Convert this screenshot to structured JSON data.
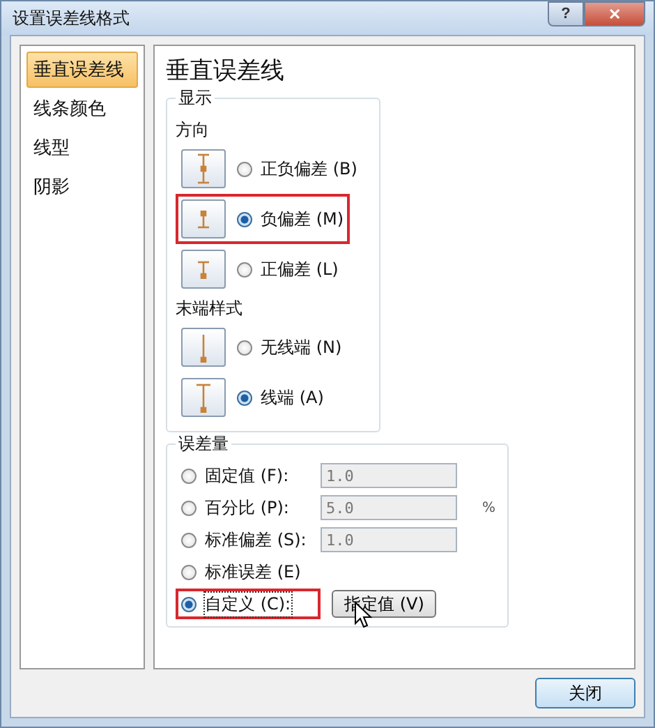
{
  "window": {
    "title": "设置误差线格式",
    "help": "?",
    "close": "✕"
  },
  "sidebar": {
    "items": [
      {
        "label": "垂直误差线",
        "selected": true
      },
      {
        "label": "线条颜色",
        "selected": false
      },
      {
        "label": "线型",
        "selected": false
      },
      {
        "label": "阴影",
        "selected": false
      }
    ]
  },
  "heading": "垂直误差线",
  "display": {
    "title": "显示",
    "direction": {
      "title": "方向",
      "options": [
        {
          "label": "正负偏差 (B)",
          "kind": "both",
          "selected": false,
          "highlighted": false
        },
        {
          "label": "负偏差 (M)",
          "kind": "minus",
          "selected": true,
          "highlighted": true
        },
        {
          "label": "正偏差 (L)",
          "kind": "plus",
          "selected": false,
          "highlighted": false
        }
      ]
    },
    "end_style": {
      "title": "末端样式",
      "options": [
        {
          "label": "无线端 (N)",
          "kind": "nocap",
          "selected": false,
          "highlighted": false
        },
        {
          "label": "线端 (A)",
          "kind": "cap",
          "selected": true,
          "highlighted": false
        }
      ]
    }
  },
  "amount": {
    "title": "误差量",
    "options": [
      {
        "label": "固定值 (F):",
        "kind": "field",
        "value": "1.0",
        "selected": false,
        "highlighted": false
      },
      {
        "label": "百分比 (P):",
        "kind": "field",
        "value": "5.0",
        "unit": "%",
        "selected": false,
        "highlighted": false
      },
      {
        "label": "标准偏差 (S):",
        "kind": "field",
        "value": "1.0",
        "selected": false,
        "highlighted": false
      },
      {
        "label": "标准误差 (E)",
        "kind": "none",
        "selected": false,
        "highlighted": false
      },
      {
        "label": "自定义 (C):",
        "kind": "button",
        "button": "指定值 (V)",
        "selected": true,
        "highlighted": true
      }
    ]
  },
  "buttons": [
    "关闭"
  ]
}
